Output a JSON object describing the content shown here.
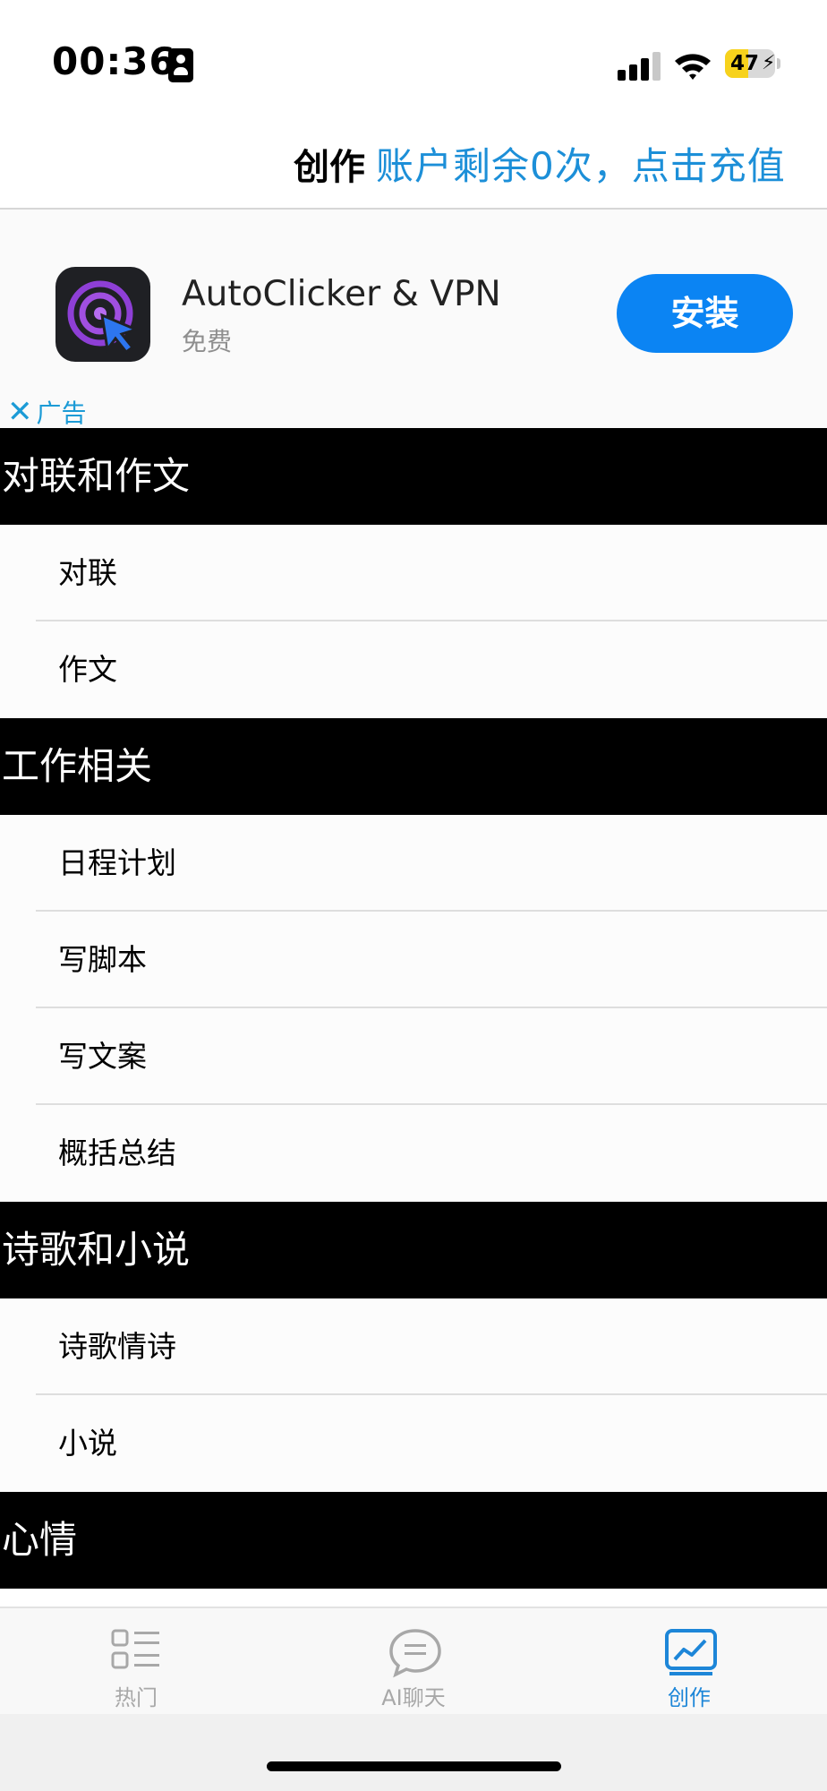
{
  "status_bar": {
    "time": "00:36",
    "battery_percent": "47",
    "battery_level": 0.47,
    "signal_bars": 3,
    "icons": [
      "id-card-icon",
      "signal-icon",
      "wifi-icon",
      "battery-charging-icon"
    ]
  },
  "header": {
    "title": "创作",
    "credits_text": "账户剩余0次，点击充值",
    "link_color": "#1c8fd8"
  },
  "ad": {
    "app_name": "AutoClicker & VPN",
    "price": "免费",
    "install_label": "安装",
    "ad_label": "广告",
    "close_glyph": "✕",
    "app_icon": "autoclicker-app-icon",
    "button_color": "#0b84f3"
  },
  "sections": [
    {
      "title": "对联和作文",
      "items": [
        "对联",
        "作文"
      ]
    },
    {
      "title": "工作相关",
      "items": [
        "日程计划",
        "写脚本",
        "写文案",
        "概括总结"
      ]
    },
    {
      "title": "诗歌和小说",
      "items": [
        "诗歌情诗",
        "小说"
      ]
    },
    {
      "title": "心情",
      "items": []
    }
  ],
  "tabbar": {
    "tabs": [
      {
        "label": "热门",
        "icon": "list-icon",
        "active": false
      },
      {
        "label": "AI聊天",
        "icon": "chat-bubble-icon",
        "active": false
      },
      {
        "label": "创作",
        "icon": "chart-icon",
        "active": true
      }
    ],
    "active_color": "#1d86d8",
    "inactive_color": "#a8a8a8"
  }
}
